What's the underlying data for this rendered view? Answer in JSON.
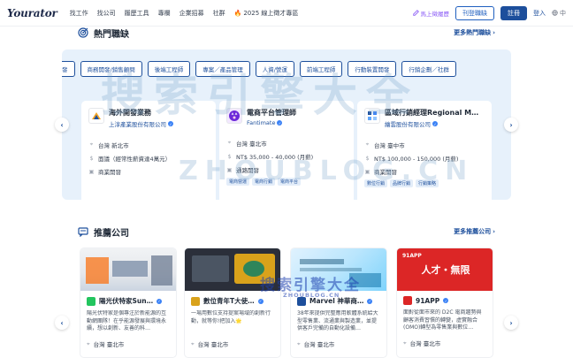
{
  "header": {
    "logo": "Yourator",
    "nav": [
      "找工作",
      "找公司",
      "履歷工具",
      "專欄",
      "企業招募",
      "社群"
    ],
    "promo_icon": "fire-icon",
    "promo": "2025 線上徵才專區",
    "hire_link": "馬上徵履歷",
    "post_job": "刊登職缺",
    "register": "註冊",
    "login": "登入",
    "lang": "中"
  },
  "hot_jobs": {
    "title": "熱門職缺",
    "more": "更多熱門職缺",
    "tags": [
      "發",
      "商務開發/銷售顧問",
      "後端工程師",
      "專案／產品管理",
      "人資/營運",
      "前端工程師",
      "行動裝置開發",
      "行銷企劃／社群"
    ],
    "jobs": [
      {
        "title": "海外開發業務",
        "company": "上淳產業股份有限公司",
        "location": "台灣 新北市",
        "salary": "面議（經常性薪資達4萬元）",
        "category": "商業開發",
        "tags": []
      },
      {
        "title": "電商平台管理師",
        "company": "Fantimate",
        "location": "台灣 臺北市",
        "salary": "NT$ 35,000 - 40,000 (月薪)",
        "category": "通路開發",
        "tags": [
          "電商營運",
          "電商行銷",
          "電商平台"
        ]
      },
      {
        "title": "區域行銷經理Regional M…",
        "company": "繪雲股份有限公司",
        "location": "台灣 臺中市",
        "salary": "NT$ 100,000 - 150,000 (月薪)",
        "category": "商業開發",
        "tags": [
          "數位行銷",
          "品牌行銷",
          "行銷策略"
        ]
      }
    ]
  },
  "companies": {
    "title": "推薦公司",
    "more": "更多推薦公司",
    "items": [
      {
        "name": "陽光伏特家Sun…",
        "desc": "陽光伏特家是個專注於新能源的互動網團隊！在乎能源發展與環境永續，想以創新、友善的科…",
        "location": "台灣 臺北市"
      },
      {
        "name": "數位青年T大使…",
        "desc": "一場用數位支持提案場域的創新行動，就等你!把加入🌟",
        "location": "台灣 臺北市"
      },
      {
        "name": "Marvel 神華商…",
        "desc": "38年來提供完整應用軟體系統給大型零售業、流通業與製造業，並提供客戶完備的自動化設備…",
        "location": "台灣 臺北市"
      },
      {
        "name": "91APP",
        "image_text": "人才・無限",
        "desc": "面對從面市來的 D2C 電商趨勢與顧客消費習慣的轉變，虛實融合(OMO)轉型為零售業與數位…",
        "location": "台灣 臺北市"
      }
    ]
  },
  "watermark": {
    "main": "搜索引擎大全",
    "url": "ZHOUBLOG.CN"
  },
  "colors": {
    "brand": "#1d4f9c",
    "panel_bg": "#e7f1fb"
  }
}
